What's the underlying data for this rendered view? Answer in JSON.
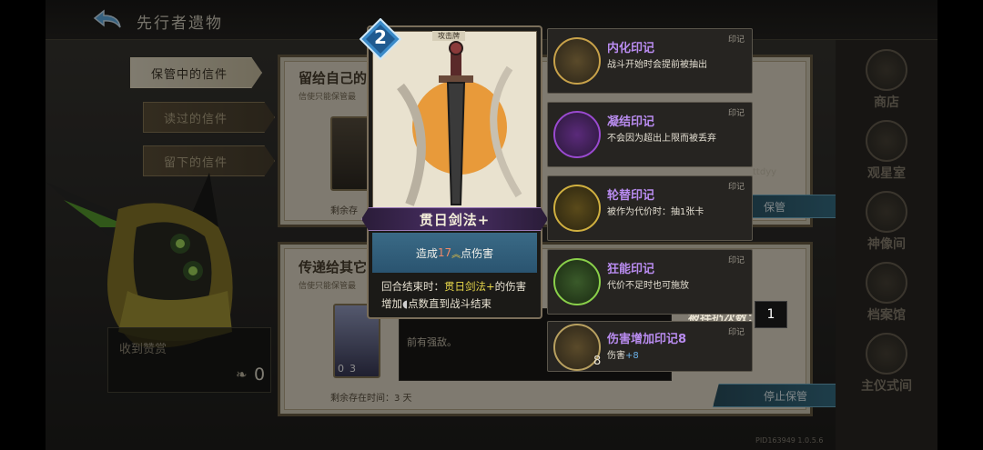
{
  "header": {
    "title": "先行者遗物"
  },
  "menu": {
    "items": [
      {
        "label": "保管中的信件",
        "active": true
      },
      {
        "label": "读过的信件",
        "active": false
      },
      {
        "label": "留下的信件",
        "active": false
      }
    ]
  },
  "panels": [
    {
      "heading": "留给自己的",
      "subtext": "信使只能保管最",
      "time": "剩余存",
      "button": "保管"
    },
    {
      "heading": "传递给其它",
      "subtext": "信使只能保管最",
      "message": "前有强敌。",
      "time": "剩余存在时间：3 天",
      "button": "停止保管",
      "card_cost": "0",
      "card_count": "3"
    }
  ],
  "right_nav": {
    "items": [
      "商店",
      "观星室",
      "神像间",
      "档案馆",
      "主仪式间"
    ]
  },
  "reward": {
    "label": "收到赞赏",
    "value": "0"
  },
  "version": "PID163949  1.0.5.6",
  "card": {
    "cost": "2",
    "type": "攻击牌",
    "name": "贯日剑法+",
    "desc_prefix": "造成",
    "desc_damage": "17",
    "desc_suffix": "点伤害",
    "effect_prefix": "回合结束时：",
    "effect_highlight": "贯日剑法+",
    "effect_mid": "的伤害增加",
    "effect_suffix": "点数直到战斗结束",
    "side_count": "8"
  },
  "seals": [
    {
      "name": "内化印记",
      "tag": "印记",
      "desc": "战斗开始时会提前被抽出",
      "color": "#c8a24a"
    },
    {
      "name": "凝结印记",
      "tag": "印记",
      "desc": "不会因为超出上限而被丢弃",
      "color": "#9a4ad0"
    },
    {
      "name": "轮替印记",
      "tag": "印记",
      "desc": "被作为代价时：抽1张卡",
      "color": "#d0b040"
    },
    {
      "name": "狂能印记",
      "tag": "印记",
      "desc": "代价不足时也可施放",
      "color": "#8ad04a"
    },
    {
      "name": "伤害增加印记8",
      "tag": "印记",
      "desc_prefix": "伤害",
      "desc_value": "+8",
      "count": "8",
      "color": "#b8a060"
    }
  ],
  "extra": {
    "label": "被拌扔次数：",
    "value": "1",
    "dust": "ttdyy"
  }
}
